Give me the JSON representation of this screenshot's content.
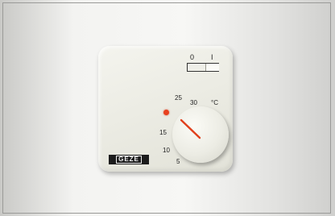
{
  "switch": {
    "label_off": "0",
    "label_on": "I"
  },
  "dial": {
    "unit": "°C",
    "scale": [
      "5",
      "10",
      "15",
      "25",
      "30"
    ]
  },
  "brand": {
    "logo_text": "GEZE"
  },
  "colors": {
    "indicator_led": "#e8401e",
    "pointer": "#e0401c",
    "plate": "#ecece4"
  }
}
